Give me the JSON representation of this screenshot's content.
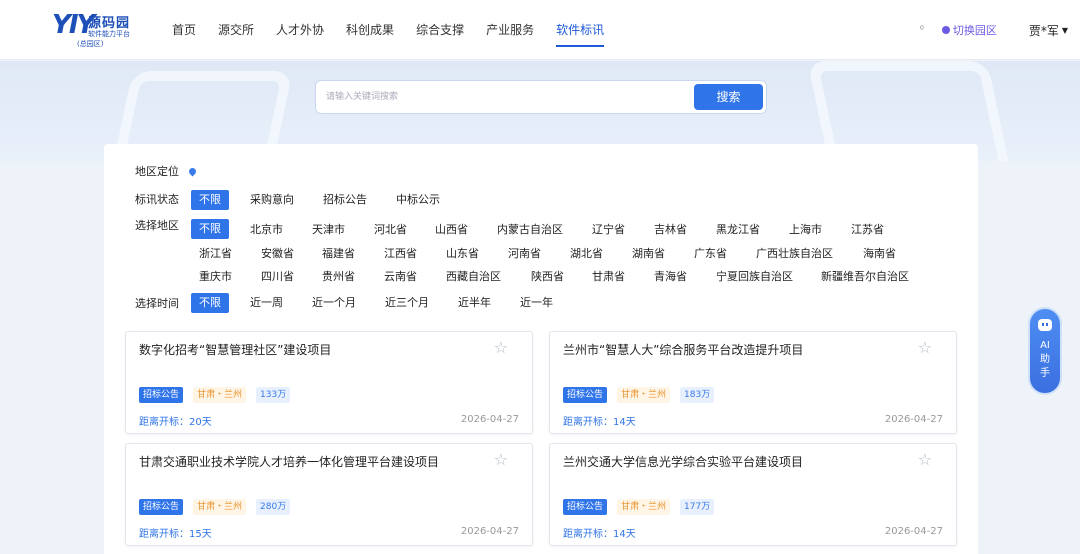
{
  "header": {
    "logo_mark": "YIY",
    "logo_name": "源码园",
    "logo_sub": "软件能力平台",
    "logo_park": "(总园区)",
    "nav": [
      "首页",
      "源交所",
      "人才外协",
      "科创成果",
      "综合支撑",
      "产业服务",
      "软件标讯"
    ],
    "active_nav": "软件标讯",
    "icon_label": "⁰",
    "switch_label": "切换园区",
    "user_name": "贾*军"
  },
  "search": {
    "placeholder": "请输入关键词搜索",
    "button": "搜索"
  },
  "filters": {
    "location_label": "地区定位",
    "status_label": "标讯状态",
    "status_options": [
      "不限",
      "采购意向",
      "招标公告",
      "中标公示"
    ],
    "region_label": "选择地区",
    "region_all": "不限",
    "region_row1": [
      "北京市",
      "天津市",
      "河北省",
      "山西省",
      "内蒙古自治区",
      "辽宁省",
      "吉林省",
      "黑龙江省",
      "上海市",
      "江苏省"
    ],
    "region_row2": [
      "浙江省",
      "安徽省",
      "福建省",
      "江西省",
      "山东省",
      "河南省",
      "湖北省",
      "湖南省",
      "广东省",
      "广西壮族自治区",
      "海南省"
    ],
    "region_row3": [
      "重庆市",
      "四川省",
      "贵州省",
      "云南省",
      "西藏自治区",
      "陕西省",
      "甘肃省",
      "青海省",
      "宁夏回族自治区",
      "新疆维吾尔自治区"
    ],
    "time_label": "选择时间",
    "time_options": [
      "不限",
      "近一周",
      "近一个月",
      "近三个月",
      "近半年",
      "近一年"
    ]
  },
  "cards": [
    {
      "title": "数字化招考“智慧管理社区”建设项目",
      "type": "招标公告",
      "area": "甘肃・兰州",
      "amount": "133万",
      "countdown": "距离开标：20天",
      "date": "2026-04-27"
    },
    {
      "title": "兰州市“智慧人大”综合服务平台改造提升项目",
      "type": "招标公告",
      "area": "甘肃・兰州",
      "amount": "183万",
      "countdown": "距离开标：14天",
      "date": "2026-04-27"
    },
    {
      "title": "甘肃交通职业技术学院人才培养一体化管理平台建设项目",
      "type": "招标公告",
      "area": "甘肃・兰州",
      "amount": "280万",
      "countdown": "距离开标：15天",
      "date": "2026-04-27"
    },
    {
      "title": "兰州交通大学信息光学综合实验平台建设项目",
      "type": "招标公告",
      "area": "甘肃・兰州",
      "amount": "177万",
      "countdown": "距离开标：14天",
      "date": "2026-04-27"
    }
  ],
  "ai_helper": {
    "l1": "AI",
    "l2": "助",
    "l3": "手"
  },
  "colors": {
    "primary": "#2f74e8",
    "accent_purple": "#6b5be2",
    "tag_orange": "#e8932c"
  }
}
